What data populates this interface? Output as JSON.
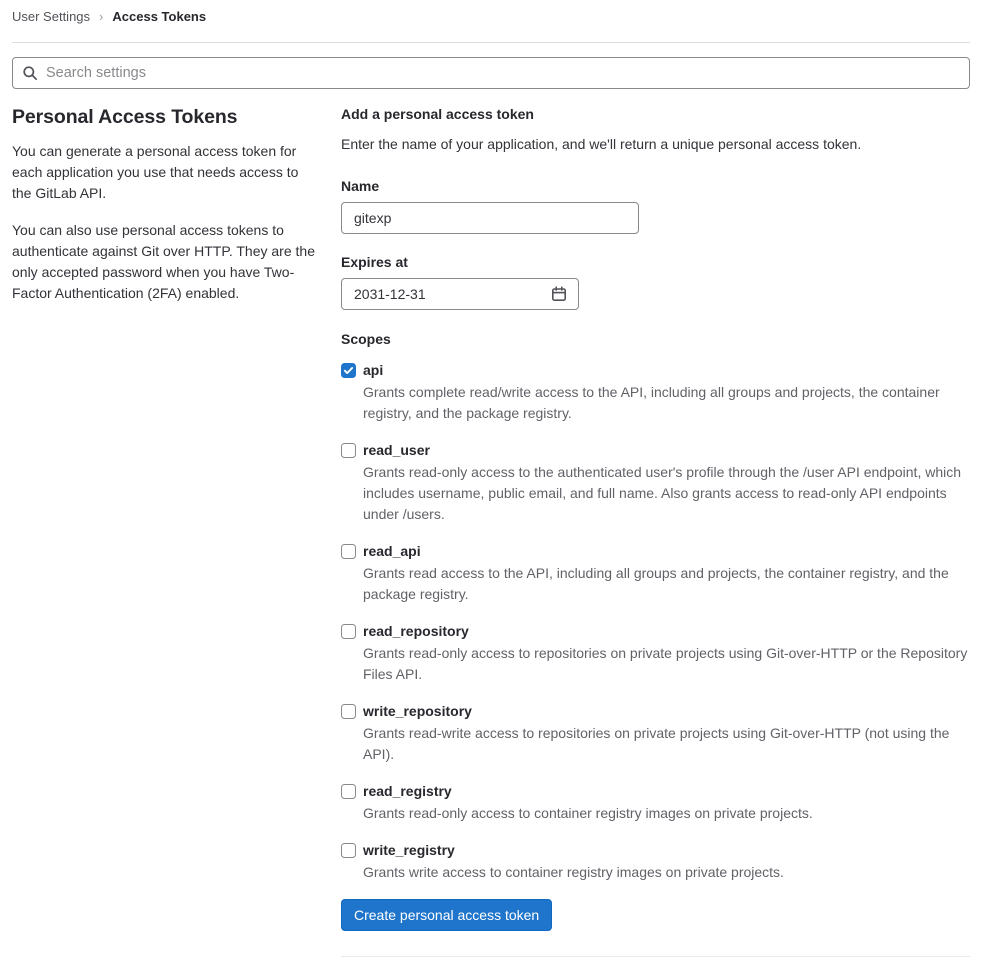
{
  "breadcrumb": {
    "separator": "›",
    "items": [
      {
        "label": "User Settings"
      },
      {
        "label": "Access Tokens"
      }
    ]
  },
  "search": {
    "placeholder": "Search settings"
  },
  "sidebar": {
    "title": "Personal Access Tokens",
    "paragraphs": [
      "You can generate a personal access token for each application you use that needs access to the GitLab API.",
      "You can also use personal access tokens to authenticate against Git over HTTP. They are the only accepted password when you have Two-Factor Authentication (2FA) enabled."
    ]
  },
  "form": {
    "title": "Add a personal access token",
    "description": "Enter the name of your application, and we'll return a unique personal access token.",
    "name_label": "Name",
    "name_value": "gitexp",
    "expires_label": "Expires at",
    "expires_value": "2031-12-31",
    "scopes_label": "Scopes",
    "scopes": [
      {
        "name": "api",
        "checked": true,
        "description": "Grants complete read/write access to the API, including all groups and projects, the container registry, and the package registry."
      },
      {
        "name": "read_user",
        "checked": false,
        "description": "Grants read-only access to the authenticated user's profile through the /user API endpoint, which includes username, public email, and full name. Also grants access to read-only API endpoints under /users."
      },
      {
        "name": "read_api",
        "checked": false,
        "description": "Grants read access to the API, including all groups and projects, the container registry, and the package registry."
      },
      {
        "name": "read_repository",
        "checked": false,
        "description": "Grants read-only access to repositories on private projects using Git-over-HTTP or the Repository Files API."
      },
      {
        "name": "write_repository",
        "checked": false,
        "description": "Grants read-write access to repositories on private projects using Git-over-HTTP (not using the API)."
      },
      {
        "name": "read_registry",
        "checked": false,
        "description": "Grants read-only access to container registry images on private projects."
      },
      {
        "name": "write_registry",
        "checked": false,
        "description": "Grants write access to container registry images on private projects."
      }
    ],
    "submit_label": "Create personal access token"
  },
  "colors": {
    "accent_blue": "#1f75cb",
    "text_dark": "#333238",
    "text_muted": "#626168",
    "input_border": "#89888d",
    "divider": "#dcdcde"
  }
}
